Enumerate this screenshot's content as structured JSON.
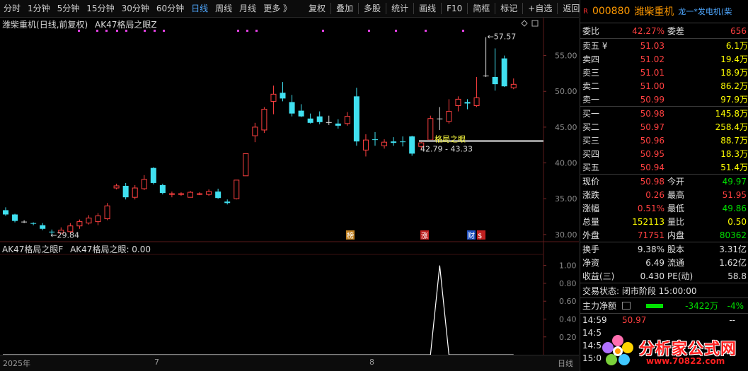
{
  "toolbar": {
    "periods": [
      "分时",
      "1分钟",
      "5分钟",
      "15分钟",
      "30分钟",
      "60分钟",
      "日线",
      "周线",
      "月线",
      "更多 》"
    ],
    "active_period": "日线",
    "tools": [
      "复权",
      "叠加",
      "多股",
      "统计",
      "画线",
      "F10",
      "简框",
      "标记",
      "+自选",
      "返回"
    ]
  },
  "chart": {
    "title": "潍柴重机",
    "title_mode": "(日线,前复权)",
    "indicator_name": "AK47格局之眼Z",
    "sub_indicator": "AK47格局之眼F",
    "sub_value_label": "AK47格局之眼: 0.00",
    "max_label": "57.57",
    "min_label": "29.84",
    "range_label": "42.79 - 43.33",
    "eye_label": "格局之眼",
    "events": [
      "榜",
      "涨",
      "财",
      "$"
    ],
    "time_labels": [
      "2025年",
      "7",
      "8"
    ],
    "bottom_tab": "日线"
  },
  "chart_data": [
    {
      "type": "candlestick",
      "y_ticks": [
        30.0,
        35.0,
        40.0,
        45.0,
        50.0,
        55.0
      ],
      "ylim": [
        29.0,
        59.5
      ],
      "colors": {
        "up": "#ff4040",
        "down": "#40e0f0",
        "doji": "#e0e0e0"
      },
      "candles": [
        [
          33.4,
          33.8,
          32.6,
          32.8
        ],
        [
          32.8,
          32.9,
          31.7,
          31.9
        ],
        [
          31.8,
          32.0,
          31.6,
          31.8
        ],
        [
          31.6,
          31.7,
          31.3,
          31.5
        ],
        [
          31.3,
          31.6,
          30.6,
          30.8
        ],
        [
          30.4,
          30.7,
          29.84,
          30.3
        ],
        [
          30.2,
          31.0,
          30.1,
          30.6
        ],
        [
          30.4,
          31.6,
          30.2,
          31.2
        ],
        [
          31.2,
          32.1,
          30.8,
          31.8
        ],
        [
          31.6,
          32.7,
          31.4,
          32.3
        ],
        [
          31.8,
          33.0,
          31.3,
          32.6
        ],
        [
          32.2,
          34.4,
          32.0,
          34.0
        ],
        [
          36.5,
          37.1,
          36.3,
          36.8
        ],
        [
          36.8,
          37.2,
          34.9,
          35.2
        ],
        [
          35.2,
          36.9,
          34.9,
          36.5
        ],
        [
          36.4,
          38.3,
          36.2,
          37.7
        ],
        [
          39.3,
          39.4,
          37.0,
          37.2
        ],
        [
          36.9,
          37.1,
          35.6,
          35.8
        ],
        [
          35.6,
          36.0,
          35.2,
          35.7
        ],
        [
          35.6,
          35.9,
          35.4,
          35.7
        ],
        [
          35.2,
          36.1,
          35.2,
          35.9
        ],
        [
          35.6,
          35.9,
          35.5,
          35.7
        ],
        [
          35.6,
          36.3,
          35.4,
          36.0
        ],
        [
          36.0,
          36.4,
          35.0,
          35.1
        ],
        [
          34.6,
          34.9,
          34.2,
          34.4
        ],
        [
          35.0,
          37.6,
          34.9,
          37.6
        ],
        [
          38.2,
          41.3,
          38.2,
          41.3
        ],
        [
          43.8,
          45.6,
          42.9,
          45.0
        ],
        [
          44.6,
          47.8,
          44.2,
          47.5
        ],
        [
          48.6,
          50.8,
          46.8,
          49.6
        ],
        [
          49.8,
          51.3,
          48.6,
          49.0
        ],
        [
          48.5,
          49.5,
          46.5,
          46.9
        ],
        [
          47.3,
          48.2,
          46.4,
          46.5
        ],
        [
          46.2,
          46.9,
          45.5,
          45.6
        ],
        [
          46.5,
          47.2,
          45.4,
          45.7
        ],
        [
          45.7,
          46.6,
          45.3,
          45.7
        ],
        [
          45.5,
          46.1,
          44.8,
          45.2
        ],
        [
          45.5,
          47.1,
          45.2,
          46.5
        ],
        [
          49.3,
          50.5,
          42.4,
          43.0
        ],
        [
          41.8,
          44.0,
          40.9,
          43.2
        ],
        [
          43.3,
          44.3,
          42.4,
          43.2
        ],
        [
          42.4,
          43.3,
          42.0,
          42.9
        ],
        [
          43.0,
          43.6,
          42.4,
          42.8
        ],
        [
          43.0,
          43.7,
          42.3,
          42.9
        ],
        [
          43.7,
          43.8,
          41.0,
          41.3
        ],
        [
          42.3,
          43.2,
          41.8,
          42.8
        ],
        [
          43.2,
          46.6,
          43.0,
          46.2
        ],
        [
          46.2,
          47.8,
          44.6,
          46.2
        ],
        [
          45.8,
          48.9,
          45.5,
          47.2
        ],
        [
          48.0,
          49.3,
          47.2,
          48.9
        ],
        [
          48.5,
          48.9,
          47.5,
          48.3
        ],
        [
          48.0,
          52.0,
          47.8,
          49.1
        ],
        [
          52.2,
          57.57,
          52.0,
          52.2
        ],
        [
          52.0,
          56.0,
          50.1,
          51.0
        ],
        [
          54.6,
          55.0,
          50.6,
          50.7
        ],
        [
          50.5,
          51.8,
          50.3,
          50.98
        ]
      ]
    },
    {
      "type": "line",
      "y_ticks": [
        0.2,
        0.4,
        0.6,
        0.8,
        1.0
      ],
      "ylim": [
        -0.15,
        1.1
      ],
      "color": "#ffffff",
      "values": [
        0,
        0,
        0,
        0,
        0,
        0,
        0,
        0,
        0,
        0,
        0,
        0,
        0,
        0,
        0,
        0,
        0,
        0,
        0,
        0,
        0,
        0,
        0,
        0,
        0,
        0,
        0,
        0,
        0,
        0,
        0,
        0,
        0,
        0,
        0,
        0,
        0,
        0,
        0,
        0,
        0,
        0,
        0,
        0,
        0,
        0,
        0,
        1,
        0,
        0,
        0,
        0,
        0,
        0,
        0,
        0
      ]
    }
  ],
  "quote": {
    "code": "000880",
    "name": "潍柴重机",
    "extra": "龙一*发电机(柴",
    "weibi_label": "委比",
    "weibi": "42.27%",
    "weicha_label": "委差",
    "weicha": "656",
    "asks": [
      {
        "label": "卖五 ¥",
        "price": "51.03",
        "vol": "6.1万"
      },
      {
        "label": "卖四",
        "price": "51.02",
        "vol": "19.4万"
      },
      {
        "label": "卖三",
        "price": "51.01",
        "vol": "18.9万"
      },
      {
        "label": "卖二",
        "price": "51.00",
        "vol": "86.2万"
      },
      {
        "label": "卖一",
        "price": "50.99",
        "vol": "97.9万"
      }
    ],
    "bids": [
      {
        "label": "买一",
        "price": "50.98",
        "vol": "145.8万"
      },
      {
        "label": "买二",
        "price": "50.97",
        "vol": "258.4万"
      },
      {
        "label": "买三",
        "price": "50.96",
        "vol": "88.7万"
      },
      {
        "label": "买四",
        "price": "50.95",
        "vol": "18.3万"
      },
      {
        "label": "买五",
        "price": "50.94",
        "vol": "51.4万"
      }
    ],
    "stats1": [
      {
        "l1": "现价",
        "v1": "50.98",
        "c1": "red",
        "l2": "今开",
        "v2": "49.97",
        "c2": "green"
      },
      {
        "l1": "涨跌",
        "v1": "0.26",
        "c1": "red",
        "l2": "最高",
        "v2": "51.95",
        "c2": "red"
      },
      {
        "l1": "涨幅",
        "v1": "0.51%",
        "c1": "red",
        "l2": "最低",
        "v2": "49.86",
        "c2": "green"
      },
      {
        "l1": "总量",
        "v1": "152113",
        "c1": "yellow",
        "l2": "量比",
        "v2": "0.50",
        "c2": "yellow"
      },
      {
        "l1": "外盘",
        "v1": "71751",
        "c1": "red",
        "l2": "内盘",
        "v2": "80362",
        "c2": "green"
      }
    ],
    "stats2": [
      {
        "l1": "换手",
        "v1": "9.38%",
        "l2": "股本",
        "v2": "3.31亿"
      },
      {
        "l1": "净资",
        "v1": "6.49",
        "l2": "流通",
        "v2": "1.62亿"
      },
      {
        "l1": "收益(三)",
        "v1": "0.430",
        "l2": "PE(动)",
        "v2": "58.8"
      }
    ],
    "status_label": "交易状态: 闭市阶段 15:00:00",
    "net_label": "主力净额",
    "net_value": "-3422万",
    "net_pct": "-4%",
    "ticks": [
      {
        "time": "14:59",
        "price": "50.97",
        "vol": "--"
      },
      {
        "time": "14:5",
        "price": "",
        "vol": ""
      },
      {
        "time": "14:5",
        "price": "",
        "vol": ""
      },
      {
        "time": "15:0",
        "price": "",
        "vol": ""
      }
    ]
  },
  "logo": {
    "text": "分析家公式网",
    "url": "www.70822.com"
  }
}
